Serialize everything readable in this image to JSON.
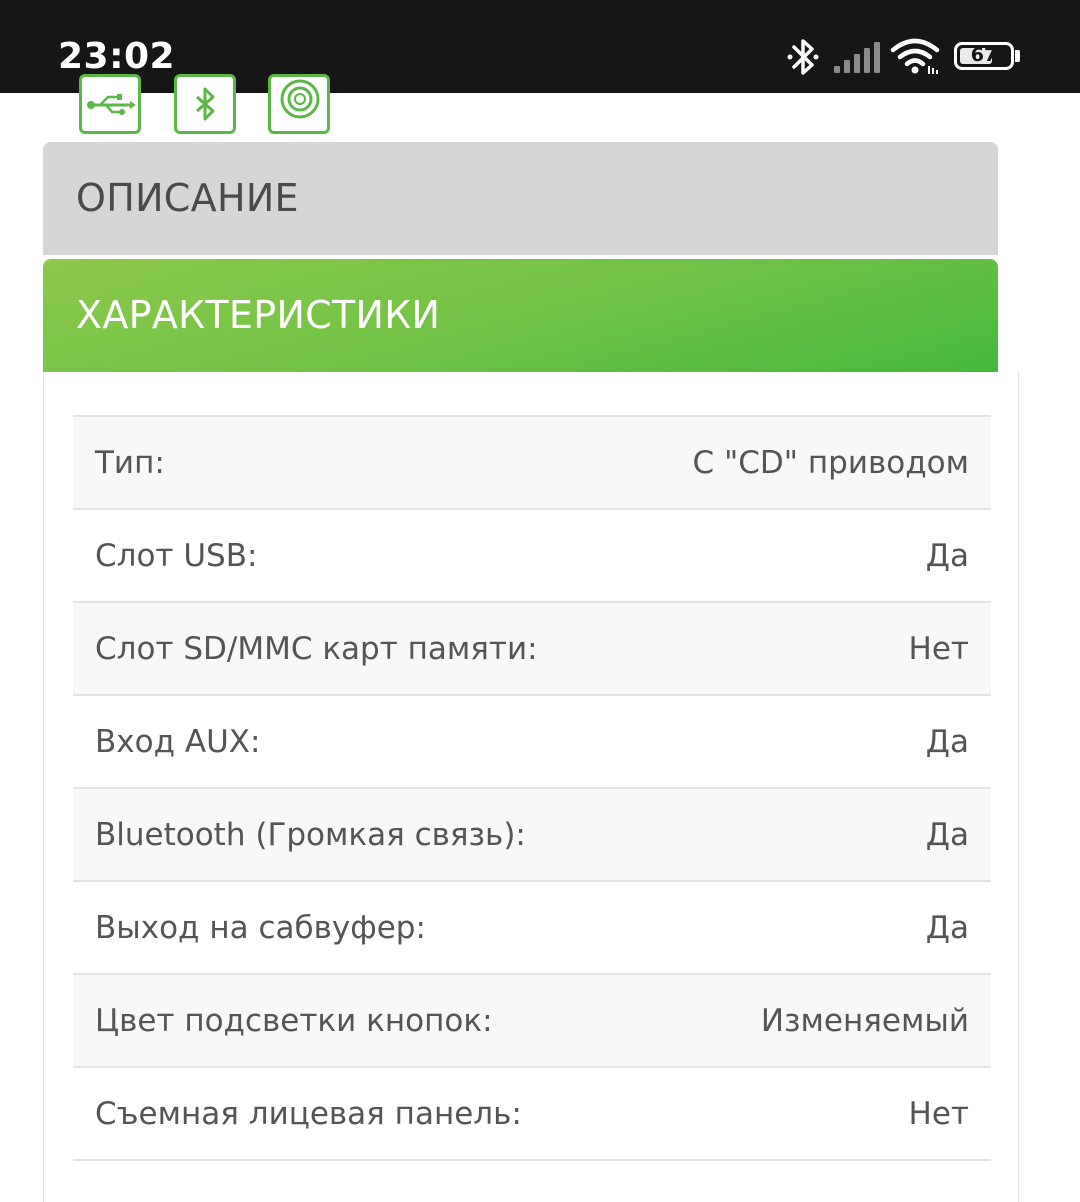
{
  "status_bar": {
    "time": "23:02",
    "battery_level": "67",
    "battery_percent": 67,
    "icons": [
      "bluetooth-icon",
      "cellular-signal-icon",
      "wifi-icon",
      "battery-icon"
    ]
  },
  "feature_icons": [
    "usb-icon",
    "bluetooth-icon",
    "speaker-icon"
  ],
  "colors": {
    "accent_green": "#6ec245",
    "icon_green": "#5bb846",
    "inactive_tab": "#d6d6d6",
    "status_bar": "#161616"
  },
  "tabs": {
    "description": "ОПИСАНИЕ",
    "specs": "ХАРАКТЕРИСТИКИ",
    "active": "specs"
  },
  "specs": [
    {
      "label": "Тип:",
      "value": "С \"CD\" приводом"
    },
    {
      "label": "Слот USB:",
      "value": "Да"
    },
    {
      "label": "Слот SD/MMC карт памяти:",
      "value": "Нет"
    },
    {
      "label": "Вход AUX:",
      "value": "Да"
    },
    {
      "label": "Bluetooth (Громкая связь):",
      "value": "Да"
    },
    {
      "label": "Выход на сабвуфер:",
      "value": "Да"
    },
    {
      "label": "Цвет подсветки кнопок:",
      "value": "Изменяемый"
    },
    {
      "label": "Съемная лицевая панель:",
      "value": "Нет"
    }
  ]
}
